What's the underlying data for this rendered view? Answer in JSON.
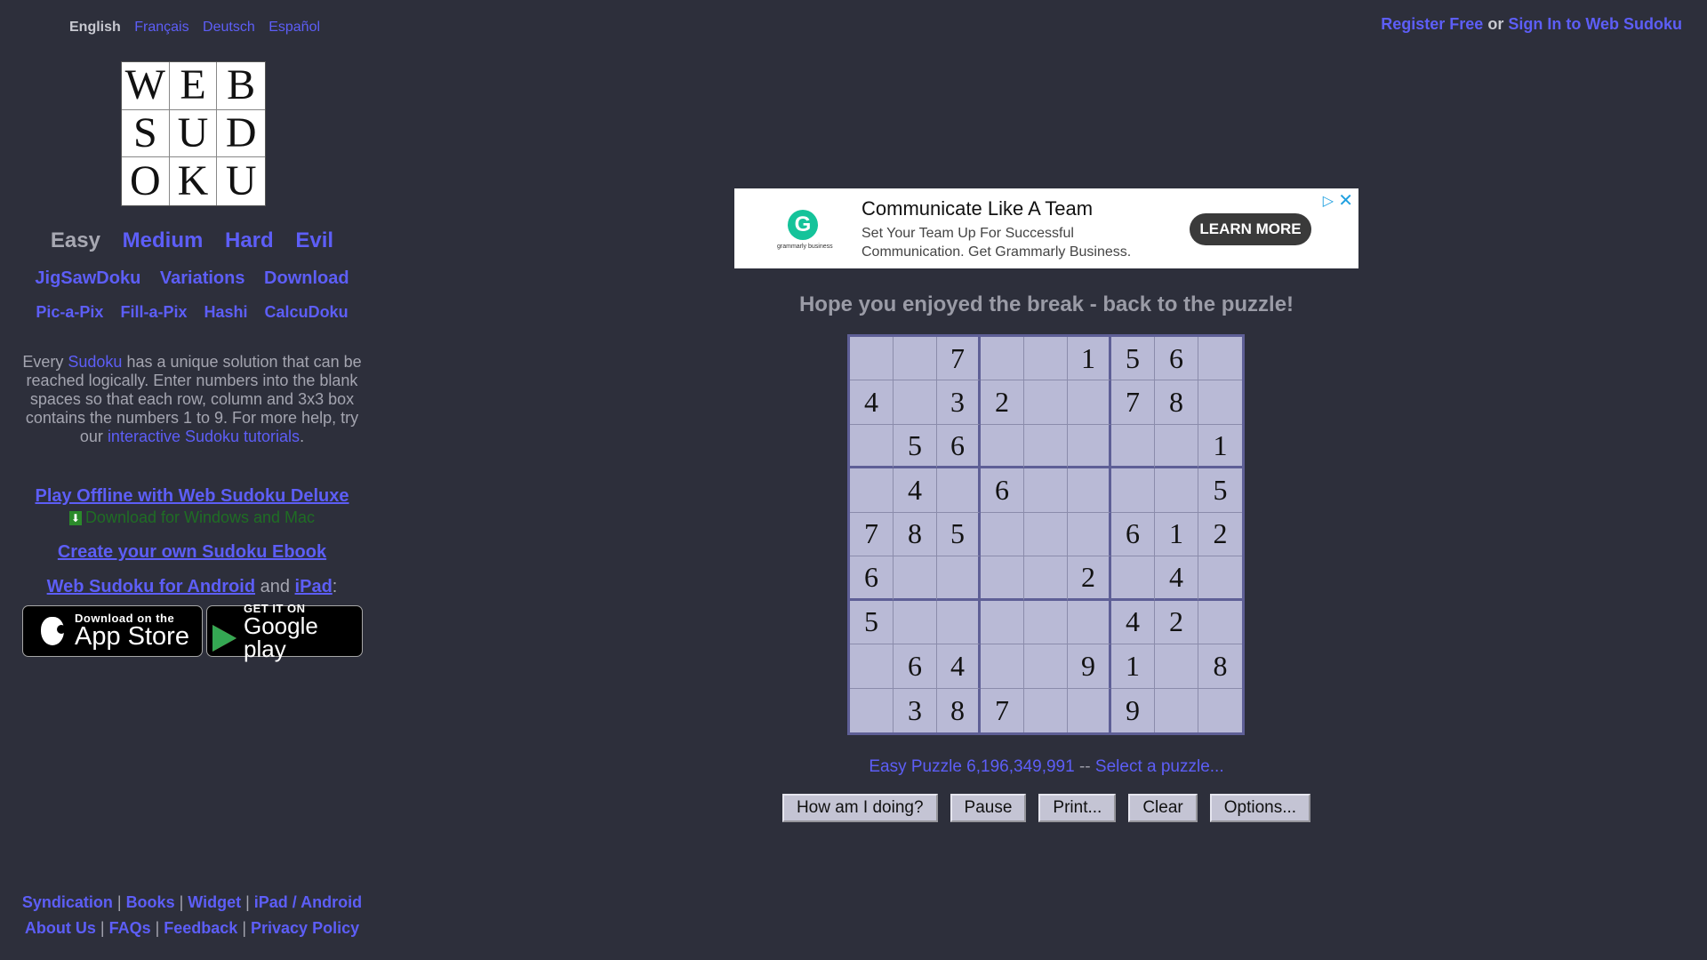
{
  "languages": [
    "English",
    "Français",
    "Deutsch",
    "Español"
  ],
  "logo": {
    "letters": [
      "W",
      "E",
      "B",
      "S",
      "U",
      "D",
      "O",
      "K",
      "U"
    ]
  },
  "levels": [
    "Easy",
    "Medium",
    "Hard",
    "Evil"
  ],
  "nav2": [
    "JigSawDoku",
    "Variations",
    "Download"
  ],
  "nav3": [
    "Pic-a-Pix",
    "Fill-a-Pix",
    "Hashi",
    "CalcuDoku"
  ],
  "intro": {
    "pre": "Every ",
    "link1": "Sudoku",
    "mid": " has a unique solution that can be reached logically. Enter numbers into the blank spaces so that each row, column and 3x3 box contains the numbers 1 to 9. For more help, try our ",
    "link2": "interactive Sudoku tutorials",
    "post": "."
  },
  "promo": {
    "offline": "Play Offline with Web Sudoku Deluxe",
    "download": "Download for Windows and Mac",
    "ebook": "Create your own Sudoku Ebook",
    "android": "Web Sudoku for Android",
    "and": " and ",
    "ipad": "iPad",
    "colon": ":"
  },
  "badges": {
    "appstore_small": "Download on the",
    "appstore_big": "App Store",
    "google_small": "GET IT ON",
    "google_big": "Google play"
  },
  "footer": {
    "row1": [
      "Syndication",
      "Books",
      "Widget",
      "iPad / Android"
    ],
    "row2": [
      "About Us",
      "FAQs",
      "Feedback",
      "Privacy Policy"
    ],
    "sep": "|"
  },
  "account": {
    "register": "Register Free",
    "or": " or ",
    "signin": "Sign In to Web Sudoku"
  },
  "ad": {
    "headline": "Communicate Like A Team",
    "body": "Set Your Team Up For Successful Communication. Get Grammarly Business.",
    "cta": "LEARN MORE",
    "logo_sub": "grammarly business",
    "logo_letter": "G"
  },
  "message": "Hope you enjoyed the break - back to the puzzle!",
  "grid": [
    [
      "",
      "",
      "7",
      "",
      "",
      "1",
      "5",
      "6",
      ""
    ],
    [
      "4",
      "",
      "3",
      "2",
      "",
      "",
      "7",
      "8",
      ""
    ],
    [
      "",
      "5",
      "6",
      "",
      "",
      "",
      "",
      "",
      "1"
    ],
    [
      "",
      "4",
      "",
      "6",
      "",
      "",
      "",
      "",
      "5"
    ],
    [
      "7",
      "8",
      "5",
      "",
      "",
      "",
      "6",
      "1",
      "2"
    ],
    [
      "6",
      "",
      "",
      "",
      "",
      "2",
      "",
      "4",
      ""
    ],
    [
      "5",
      "",
      "",
      "",
      "",
      "",
      "4",
      "2",
      ""
    ],
    [
      "",
      "6",
      "4",
      "",
      "",
      "9",
      "1",
      "",
      "8"
    ],
    [
      "",
      "3",
      "8",
      "7",
      "",
      "",
      "9",
      "",
      ""
    ]
  ],
  "puzzle": {
    "label": "Easy Puzzle 6,196,349,991",
    "sep": " -- ",
    "select": "Select a puzzle..."
  },
  "buttons": [
    "How am I doing?",
    "Pause",
    "Print...",
    "Clear",
    "Options..."
  ]
}
